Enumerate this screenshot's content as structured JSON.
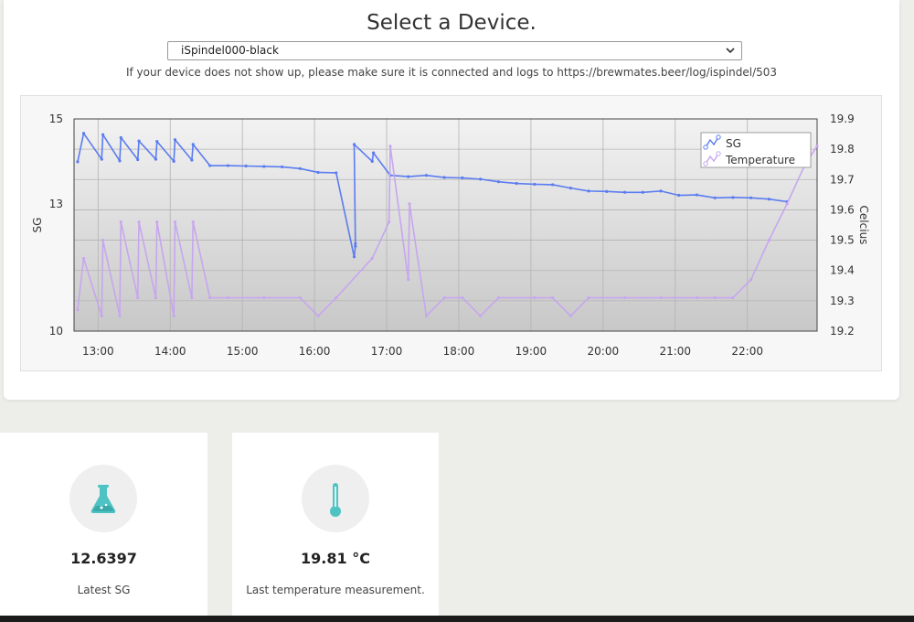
{
  "header": {
    "title": "Select a Device.",
    "selected_device": "iSpindel000-black",
    "help_text": "If your device does not show up, please make sure it is connected and logs to https://brewmates.beer/log/ispindel/503"
  },
  "chart_data": {
    "type": "line",
    "left_axis": {
      "label": "SG",
      "ylim": [
        10,
        15
      ],
      "ticks": [
        "15",
        "13",
        "10"
      ]
    },
    "right_axis": {
      "label": "Celcius",
      "ylim": [
        19.2,
        19.9
      ],
      "ticks": [
        "19.9",
        "19.8",
        "19.7",
        "19.6",
        "19.5",
        "19.4",
        "19.3",
        "19.2"
      ]
    },
    "x_ticks": [
      "13:00",
      "14:00",
      "15:00",
      "16:00",
      "17:00",
      "18:00",
      "19:00",
      "20:00",
      "21:00",
      "22:00"
    ],
    "legend": {
      "position": "top-right",
      "entries": [
        "SG",
        "Temperature"
      ]
    },
    "grid": true,
    "series": [
      {
        "name": "SG",
        "axis": "left",
        "color": "#5b7cf0",
        "points": [
          [
            "12:43",
            13.99
          ],
          [
            "12:48",
            14.66
          ],
          [
            "13:03",
            14.05
          ],
          [
            "13:04",
            14.63
          ],
          [
            "13:18",
            14.01
          ],
          [
            "13:19",
            14.56
          ],
          [
            "13:33",
            14.04
          ],
          [
            "13:34",
            14.48
          ],
          [
            "13:48",
            14.05
          ],
          [
            "13:49",
            14.47
          ],
          [
            "14:03",
            14.0
          ],
          [
            "14:04",
            14.51
          ],
          [
            "14:18",
            14.03
          ],
          [
            "14:19",
            14.4
          ],
          [
            "14:33",
            13.9
          ],
          [
            "14:48",
            13.9
          ],
          [
            "15:03",
            13.89
          ],
          [
            "15:18",
            13.88
          ],
          [
            "15:33",
            13.87
          ],
          [
            "15:48",
            13.83
          ],
          [
            "16:03",
            13.74
          ],
          [
            "16:18",
            13.73
          ],
          [
            "16:33",
            11.75
          ],
          [
            "16:34",
            12.0
          ],
          [
            "16:34",
            12.06
          ],
          [
            "16:33",
            14.4
          ],
          [
            "16:48",
            14.0
          ],
          [
            "16:49",
            14.2
          ],
          [
            "17:03",
            13.67
          ],
          [
            "17:18",
            13.64
          ],
          [
            "17:33",
            13.67
          ],
          [
            "17:48",
            13.62
          ],
          [
            "18:03",
            13.61
          ],
          [
            "18:18",
            13.58
          ],
          [
            "18:33",
            13.52
          ],
          [
            "18:48",
            13.48
          ],
          [
            "19:03",
            13.46
          ],
          [
            "19:18",
            13.45
          ],
          [
            "19:33",
            13.37
          ],
          [
            "19:48",
            13.3
          ],
          [
            "20:03",
            13.29
          ],
          [
            "20:18",
            13.27
          ],
          [
            "20:33",
            13.27
          ],
          [
            "20:48",
            13.3
          ],
          [
            "21:03",
            13.2
          ],
          [
            "21:18",
            13.21
          ],
          [
            "21:33",
            13.14
          ],
          [
            "21:48",
            13.15
          ],
          [
            "22:03",
            13.14
          ],
          [
            "22:18",
            13.11
          ],
          [
            "22:33",
            13.05
          ]
        ]
      },
      {
        "name": "Temperature",
        "axis": "right",
        "color": "#c7a6ef",
        "points": [
          [
            "12:43",
            19.27
          ],
          [
            "12:48",
            19.44
          ],
          [
            "13:03",
            19.25
          ],
          [
            "13:04",
            19.5
          ],
          [
            "13:18",
            19.25
          ],
          [
            "13:19",
            19.56
          ],
          [
            "13:33",
            19.31
          ],
          [
            "13:34",
            19.56
          ],
          [
            "13:48",
            19.31
          ],
          [
            "13:49",
            19.56
          ],
          [
            "14:03",
            19.25
          ],
          [
            "14:04",
            19.56
          ],
          [
            "14:18",
            19.31
          ],
          [
            "14:19",
            19.56
          ],
          [
            "14:33",
            19.31
          ],
          [
            "14:48",
            19.31
          ],
          [
            "15:18",
            19.31
          ],
          [
            "15:48",
            19.31
          ],
          [
            "16:03",
            19.25
          ],
          [
            "16:18",
            19.31
          ],
          [
            "16:48",
            19.44
          ],
          [
            "17:02",
            19.56
          ],
          [
            "17:03",
            19.81
          ],
          [
            "17:18",
            19.37
          ],
          [
            "17:19",
            19.62
          ],
          [
            "17:33",
            19.25
          ],
          [
            "17:48",
            19.31
          ],
          [
            "18:03",
            19.31
          ],
          [
            "18:18",
            19.25
          ],
          [
            "18:33",
            19.31
          ],
          [
            "19:03",
            19.31
          ],
          [
            "19:18",
            19.31
          ],
          [
            "19:33",
            19.25
          ],
          [
            "19:48",
            19.31
          ],
          [
            "20:18",
            19.31
          ],
          [
            "20:48",
            19.31
          ],
          [
            "21:18",
            19.31
          ],
          [
            "21:33",
            19.31
          ],
          [
            "21:48",
            19.31
          ],
          [
            "22:03",
            19.37
          ],
          [
            "22:18",
            19.5
          ],
          [
            "22:33",
            19.62
          ],
          [
            "22:48",
            19.75
          ],
          [
            "22:58",
            19.81
          ]
        ]
      }
    ]
  },
  "cards": [
    {
      "value": "12.6397",
      "label": "Latest SG",
      "icon": "flask-icon"
    },
    {
      "value": "19.81 °C",
      "label": "Last temperature measurement.",
      "icon": "thermometer-icon"
    }
  ]
}
